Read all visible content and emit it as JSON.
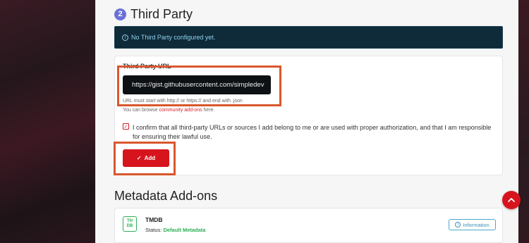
{
  "section": {
    "step": "2",
    "title": "Third Party"
  },
  "alert": {
    "icon": "info-circle-icon",
    "text": "No Third Party configured yet."
  },
  "form": {
    "url_label": "Third Party URL",
    "url_value": "https://gist.githubusercontent.com/simpledev",
    "url_hint": "URL must start with http:// or https:// and end with .json",
    "browse_prefix": "You can browse ",
    "browse_link": "community add-ons",
    "browse_suffix": " here.",
    "confirm_checked": true,
    "confirm_text": "I confirm that all third-party URLs or sources I add belong to me or are used with proper authorization, and that I am responsible for ensuring their lawful use.",
    "add_label": "Add"
  },
  "metadata": {
    "title": "Metadata Add-ons",
    "addon": {
      "logo_line1": "TH",
      "logo_line2": "DB",
      "name": "TMDB",
      "status_label": "Status:",
      "status_value": "Default Metadata",
      "info_label": "Information"
    }
  },
  "colors": {
    "accent": "#d7141d",
    "step_badge": "#6b72d6",
    "alert_bg": "#0f2a38",
    "alert_text": "#8fd3f0",
    "status_green": "#2eaf55",
    "highlight": "#d9572d"
  }
}
